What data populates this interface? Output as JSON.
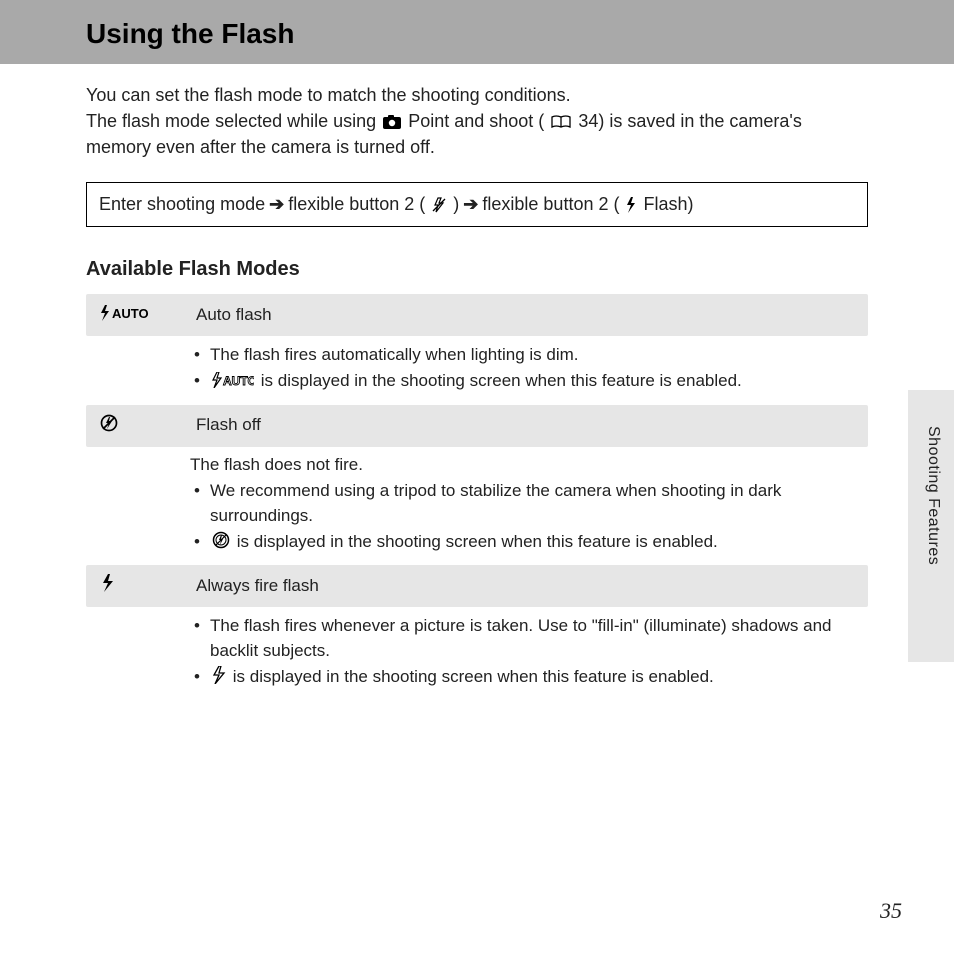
{
  "title": "Using the Flash",
  "intro": {
    "line1": "You can set the flash mode to match the shooting conditions.",
    "line2a": "The flash mode selected while using ",
    "line2b": " Point and shoot (",
    "line2c": " 34) is saved in the camera's memory even after the camera is turned off."
  },
  "nav": {
    "step1": "Enter shooting mode ",
    "step2": " flexible button 2 (",
    "step2b": ") ",
    "step3": " flexible button 2 (",
    "step3b": " Flash)"
  },
  "subheading": "Available Flash Modes",
  "modes": [
    {
      "icon_label": "⚡AUTO",
      "name": "Auto flash",
      "lead": "",
      "bullets": [
        "The flash fires automatically when lighting is dim.",
        " is displayed in the shooting screen when this feature is enabled."
      ],
      "bullet_icons": [
        "",
        "auto-outline"
      ]
    },
    {
      "icon_label": "⊘",
      "name": "Flash off",
      "lead": "The flash does not fire.",
      "bullets": [
        "We recommend using a tripod to stabilize the camera when shooting in dark surroundings.",
        " is displayed in the shooting screen when this feature is enabled."
      ],
      "bullet_icons": [
        "",
        "off-circle"
      ]
    },
    {
      "icon_label": "⚡",
      "name": "Always fire flash",
      "lead": "",
      "bullets": [
        "The flash fires whenever a picture is taken. Use to \"fill-in\" (illuminate) shadows and backlit subjects.",
        " is displayed in the shooting screen when this feature is enabled."
      ],
      "bullet_icons": [
        "",
        "flash-outline"
      ]
    }
  ],
  "side_label": "Shooting Features",
  "page_number": "35"
}
